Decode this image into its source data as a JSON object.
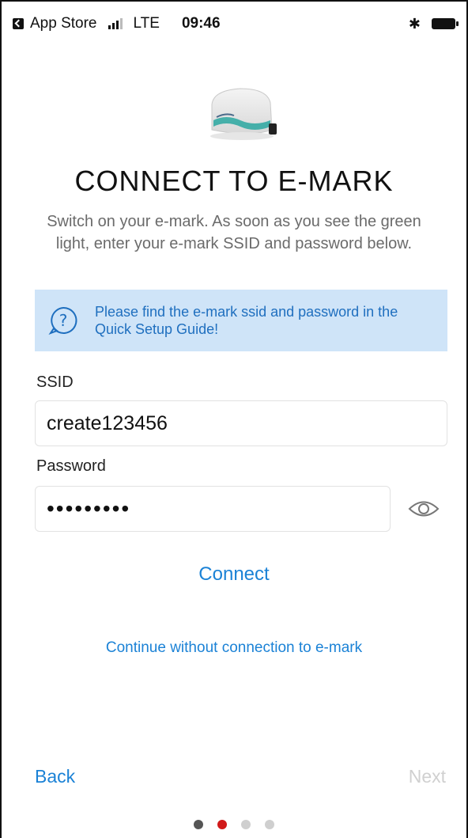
{
  "status_bar": {
    "back_app": "App Store",
    "network": "LTE",
    "time": "09:46"
  },
  "header": {
    "title": "CONNECT TO E-MARK",
    "subtitle": "Switch on your e-mark. As soon as you see the green light, enter your e-mark SSID and password below."
  },
  "info": {
    "text": "Please find the e-mark ssid and password in the Quick Setup Guide!",
    "icon": "help-circle-icon"
  },
  "form": {
    "ssid_label": "SSID",
    "ssid_value": "create123456",
    "password_label": "Password",
    "password_value": "•••••••••"
  },
  "actions": {
    "connect": "Connect",
    "continue_without": "Continue without connection to e-mark"
  },
  "footer": {
    "back": "Back",
    "next": "Next",
    "page_count": 4,
    "active_page": 2
  },
  "colors": {
    "accent": "#1b82d6",
    "info_bg": "#cfe4f8",
    "active_dot": "#d11a1a",
    "disabled": "#d0d0d0"
  }
}
